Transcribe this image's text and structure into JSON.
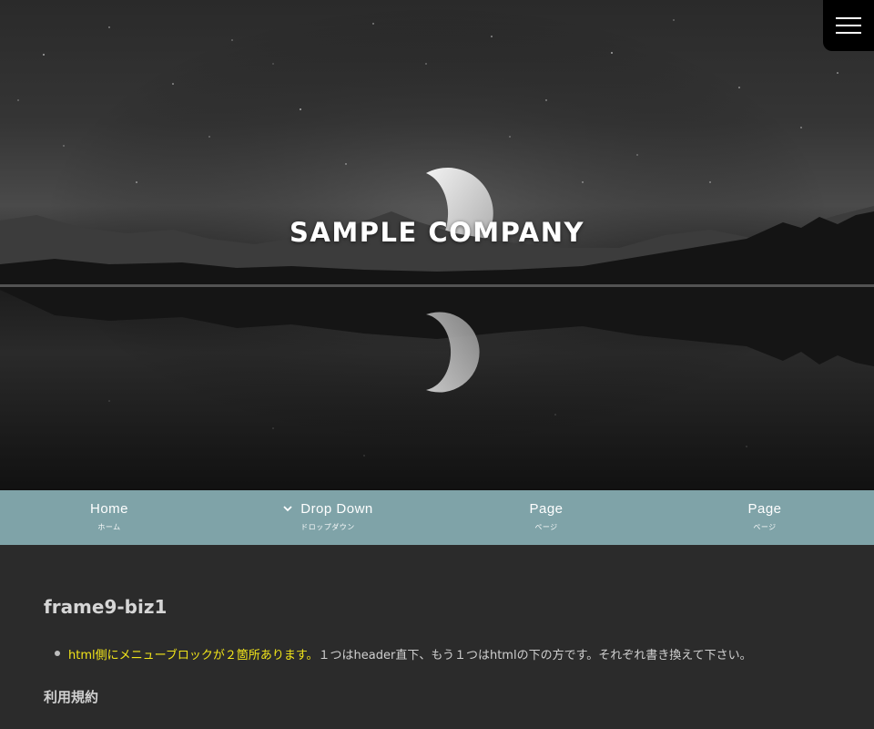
{
  "site": {
    "title": "SAMPLE COMPANY"
  },
  "menu_toggle": {
    "icon": "hamburger-menu-icon"
  },
  "nav": {
    "items": [
      {
        "label": "Home",
        "sub": "ホーム"
      },
      {
        "label": "Drop Down",
        "sub": "ドロップダウン",
        "icon": "chevron-down-icon"
      },
      {
        "label": "Page",
        "sub": "ページ"
      },
      {
        "label": "Page",
        "sub": "ページ"
      }
    ]
  },
  "content": {
    "heading": "frame9-biz1",
    "list": [
      {
        "highlight": "html側にメニューブロックが２箇所あります。",
        "text": "１つはheader直下、もう１つはhtmlの下の方です。それぞれ書き換えて下さい。"
      }
    ],
    "subheading": "利用規約"
  },
  "colors": {
    "nav_bg": "#7fa3a8",
    "content_bg": "#2b2b2b",
    "highlight": "#f2e51a",
    "menu_toggle_bg": "#000000"
  }
}
